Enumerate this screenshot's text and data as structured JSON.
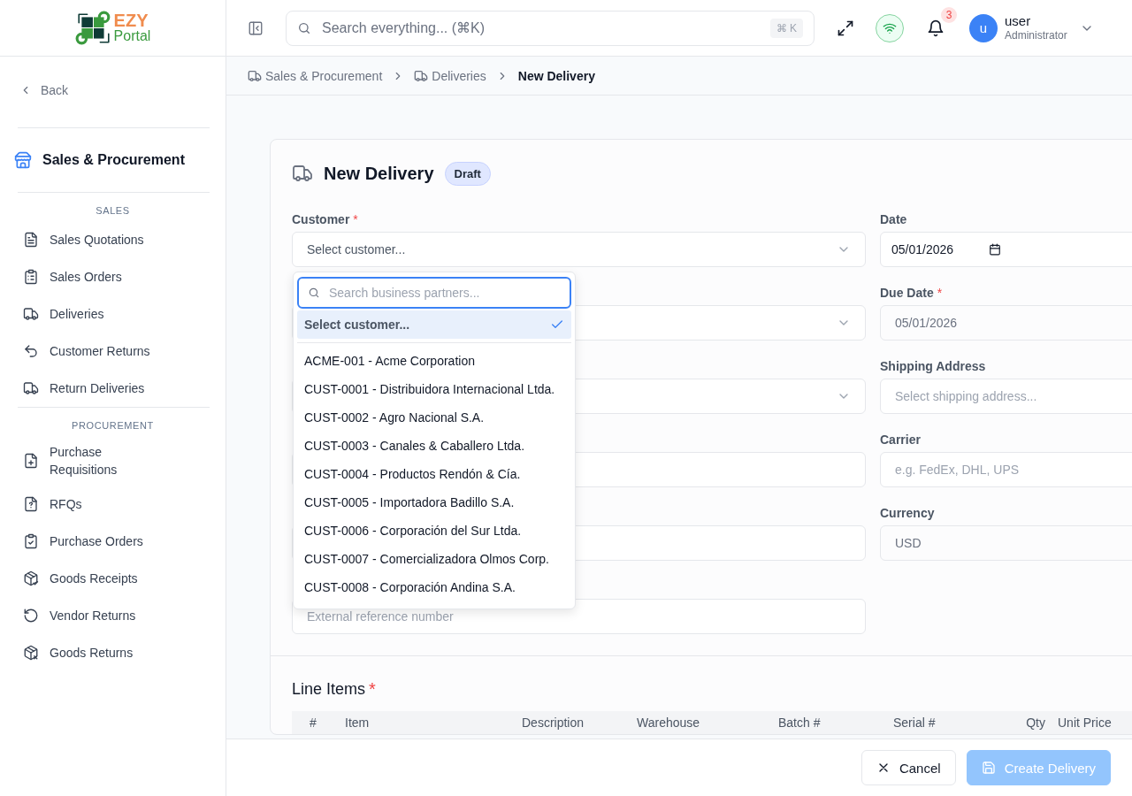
{
  "logo": {
    "brand": "EZY",
    "sub": "Portal"
  },
  "header": {
    "search_placeholder": "Search everything... (⌘K)",
    "shortcut": "⌘ K",
    "notifications": "3",
    "user": {
      "initial": "u",
      "name": "user",
      "role": "Administrator"
    }
  },
  "sidebar": {
    "back": "Back",
    "module": "Sales & Procurement",
    "sections": [
      {
        "title": "SALES",
        "items": [
          {
            "label": "Sales Quotations",
            "kind": "document"
          },
          {
            "label": "Sales Orders",
            "kind": "clipboard-list"
          },
          {
            "label": "Deliveries",
            "kind": "truck"
          },
          {
            "label": "Customer Returns",
            "kind": "undo"
          },
          {
            "label": "Return Deliveries",
            "kind": "truck"
          }
        ]
      },
      {
        "title": "PROCUREMENT",
        "items": [
          {
            "label": "Purchase Requisitions",
            "kind": "file-plus"
          },
          {
            "label": "RFQs",
            "kind": "file-question"
          },
          {
            "label": "Purchase Orders",
            "kind": "clipboard-check"
          },
          {
            "label": "Goods Receipts",
            "kind": "package-check"
          },
          {
            "label": "Vendor Returns",
            "kind": "rotate"
          },
          {
            "label": "Goods Returns",
            "kind": "package-x"
          }
        ]
      }
    ]
  },
  "breadcrumb": [
    {
      "label": "Sales & Procurement",
      "current": false
    },
    {
      "label": "Deliveries",
      "current": false
    },
    {
      "label": "New Delivery",
      "current": true
    }
  ],
  "required_mark": "*",
  "form": {
    "title": "New Delivery",
    "status": "Draft",
    "left_fields": [
      {
        "kind": "select",
        "label": "Customer",
        "required": true,
        "placeholder": "Select customer..."
      },
      {
        "kind": "select"
      },
      {
        "kind": "select"
      },
      {
        "kind": "text"
      },
      {
        "kind": "text"
      },
      {
        "kind": "text",
        "placeholder": "External reference number"
      }
    ],
    "right_fields": [
      {
        "kind": "date",
        "label": "Date",
        "required": false,
        "value": "05/01/2026"
      },
      {
        "kind": "text",
        "label": "Due Date",
        "required": true,
        "value": "05/01/2026",
        "disabled": true
      },
      {
        "kind": "text",
        "label": "Shipping Address",
        "required": false,
        "placeholder": "Select shipping address..."
      },
      {
        "kind": "text",
        "label": "Carrier",
        "required": false,
        "placeholder": "e.g. FedEx, DHL, UPS"
      },
      {
        "kind": "text",
        "label": "Currency",
        "required": false,
        "value": "USD",
        "disabled": true
      }
    ],
    "line_items": {
      "title": "Line Items",
      "required": true,
      "columns": [
        "#",
        "Item",
        "Description",
        "Warehouse",
        "Batch #",
        "Serial #",
        "Qty",
        "Unit Price"
      ]
    }
  },
  "dropdown": {
    "search_placeholder": "Search business partners...",
    "options": [
      {
        "label": "Select customer...",
        "selected": true
      },
      {
        "label": "ACME-001 - Acme Corporation",
        "selected": false
      },
      {
        "label": "CUST-0001 - Distribuidora Internacional Ltda.",
        "selected": false
      },
      {
        "label": "CUST-0002 - Agro Nacional S.A.",
        "selected": false
      },
      {
        "label": "CUST-0003 - Canales & Caballero Ltda.",
        "selected": false
      },
      {
        "label": "CUST-0004 - Productos Rendón & Cía.",
        "selected": false
      },
      {
        "label": "CUST-0005 - Importadora Badillo S.A.",
        "selected": false
      },
      {
        "label": "CUST-0006 - Corporación del Sur Ltda.",
        "selected": false
      },
      {
        "label": "CUST-0007 - Comercializadora Olmos Corp.",
        "selected": false
      },
      {
        "label": "CUST-0008 - Corporación Andina S.A.",
        "selected": false
      }
    ]
  },
  "footer": {
    "buttons": [
      {
        "label": "Cancel",
        "kind": "cancel",
        "disabled": false
      },
      {
        "label": "Create Delivery",
        "kind": "save",
        "disabled": true
      }
    ]
  }
}
